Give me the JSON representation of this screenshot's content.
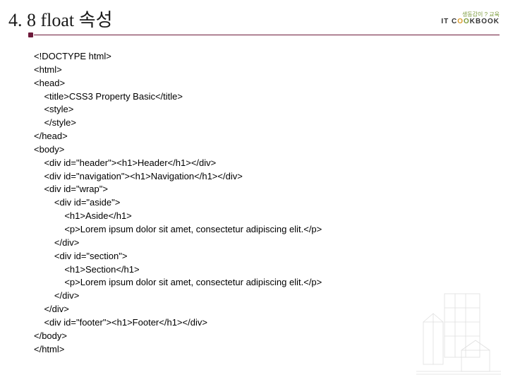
{
  "title": "4. 8 float 속성",
  "logo": {
    "tagline": "생동감이 ? 교육",
    "brand_pre": "IT C",
    "brand_o1": "O",
    "brand_o2": "O",
    "brand_post": "KBOOK"
  },
  "code_lines": [
    "<!DOCTYPE html>",
    "<html>",
    "<head>",
    "    <title>CSS3 Property Basic</title>",
    "    <style>",
    "    </style>",
    "</head>",
    "<body>",
    "    <div id=\"header\"><h1>Header</h1></div>",
    "    <div id=\"navigation\"><h1>Navigation</h1></div>",
    "    <div id=\"wrap\">",
    "        <div id=\"aside\">",
    "            <h1>Aside</h1>",
    "            <p>Lorem ipsum dolor sit amet, consectetur adipiscing elit.</p>",
    "        </div>",
    "        <div id=\"section\">",
    "            <h1>Section</h1>",
    "            <p>Lorem ipsum dolor sit amet, consectetur adipiscing elit.</p>",
    "        </div>",
    "    </div>",
    "    <div id=\"footer\"><h1>Footer</h1></div>",
    "</body>",
    "</html>"
  ]
}
